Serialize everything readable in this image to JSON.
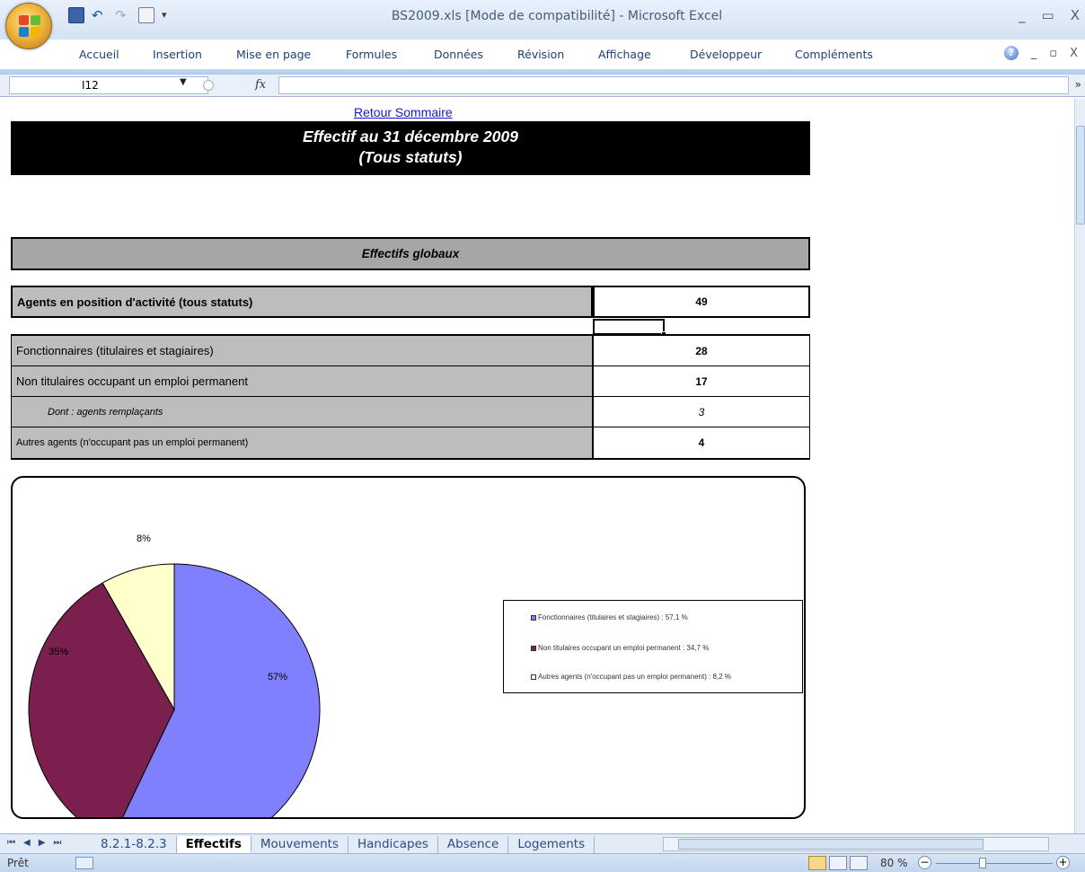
{
  "window": {
    "title": "BS2009.xls  [Mode de compatibilité] - Microsoft Excel",
    "minimize": "_",
    "maximize": "▭",
    "close": "X"
  },
  "ribbon": {
    "tabs": [
      "Accueil",
      "Insertion",
      "Mise en page",
      "Formules",
      "Données",
      "Révision",
      "Affichage",
      "Développeur",
      "Compléments"
    ],
    "help": "?",
    "doc_minimize": "_",
    "doc_restore": "▫",
    "doc_close": "X"
  },
  "formula_bar": {
    "name_box": "I12",
    "fx": "fx",
    "formula": "",
    "expand": "»"
  },
  "sheet": {
    "link": "Retour Sommaire",
    "title_line1": "Effectif au 31 décembre 2009",
    "title_line2": "(Tous statuts)",
    "section_header": "Effectifs globaux",
    "rows": [
      {
        "label": "Agents en position d'activité (tous statuts)",
        "value": "49"
      },
      {
        "label": "Fonctionnaires (titulaires et stagiaires)",
        "value": "28"
      },
      {
        "label": "Non titulaires occupant un emploi permanent",
        "value": "17"
      },
      {
        "label": "Dont : agents remplaçants",
        "value": "3"
      },
      {
        "label": "Autres agents (n'occupant pas un emploi permanent)",
        "value": "4"
      }
    ]
  },
  "chart_data": {
    "type": "pie",
    "categories": [
      "Fonctionnaires (titulaires et stagiaires)",
      "Non titulaires occupant un emploi permanent",
      "Autres agents (n'occupant pas un emploi permanent)"
    ],
    "values": [
      57.1,
      34.7,
      8.2
    ],
    "data_labels": [
      "57%",
      "35%",
      "8%"
    ],
    "legend": [
      "Fonctionnaires (titulaires et stagiaires) : 57,1 %",
      "Non titulaires occupant un emploi permanent  : 34,7 %",
      "Autres agents (n'occupant pas un emploi permanent)  : 8,2 %"
    ],
    "colors": [
      "#8080ff",
      "#7b1f4e",
      "#ffffcc"
    ],
    "legend_placement": "right"
  },
  "sheet_tabs": {
    "nav": [
      "⏮",
      "◀",
      "▶",
      "⏭"
    ],
    "tabs": [
      "8.2.1-8.2.3",
      "Effectifs",
      "Mouvements",
      "Handicapes",
      "Absence",
      "Logements"
    ],
    "active": "Effectifs"
  },
  "status": {
    "text": "Prêt",
    "zoom": "80 %",
    "zoom_minus": "−",
    "zoom_plus": "+"
  }
}
